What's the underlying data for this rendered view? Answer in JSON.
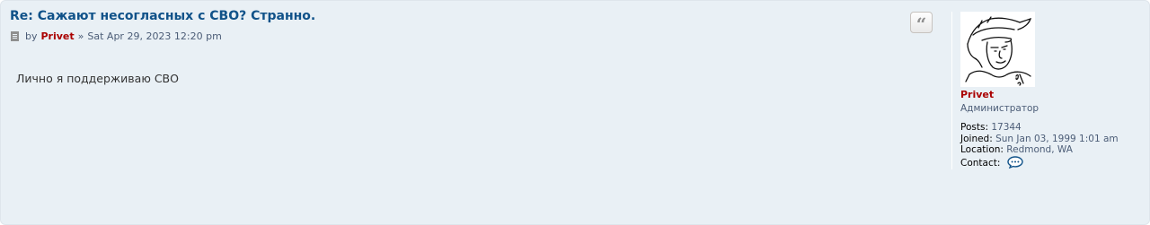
{
  "post": {
    "title": "Re: Сажают несогласных с СВО? Странно.",
    "by_label": "by",
    "author": "Privet",
    "separator": "»",
    "timestamp": "Sat Apr 29, 2023 12:20 pm",
    "content": "Лично я поддерживаю СВО"
  },
  "actions": {
    "quote_icon": "quote-icon"
  },
  "profile": {
    "username": "Privet",
    "rank": "Администратор",
    "details": [
      {
        "label": "Posts:",
        "value": "17344"
      },
      {
        "label": "Joined:",
        "value": "Sun Jan 03, 1999 1:01 am"
      },
      {
        "label": "Location:",
        "value": "Redmond, WA"
      }
    ],
    "contact_label": "Contact:",
    "contact_icon": "speech-bubble-icon"
  },
  "colors": {
    "background": "#e9f0f5",
    "title": "#105289",
    "username": "#aa0000",
    "muted": "#4c5d77"
  }
}
